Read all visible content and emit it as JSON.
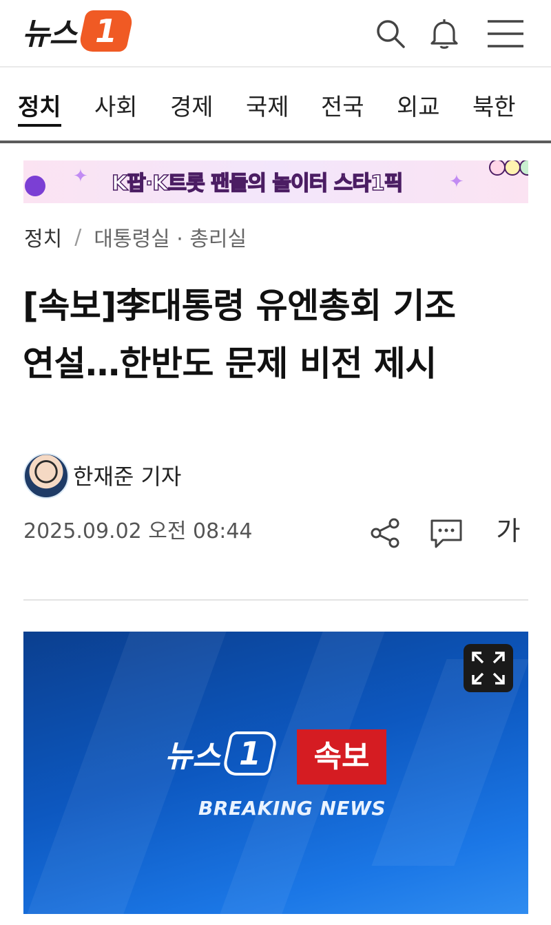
{
  "header": {
    "logo_text": "뉴스",
    "logo_mark": "1",
    "brand_color": "#f05a24",
    "icons": [
      "search-icon",
      "bell-icon",
      "menu-icon"
    ]
  },
  "nav": {
    "items": [
      {
        "label": "정치",
        "active": true
      },
      {
        "label": "사회",
        "active": false
      },
      {
        "label": "경제",
        "active": false
      },
      {
        "label": "국제",
        "active": false
      },
      {
        "label": "전국",
        "active": false
      },
      {
        "label": "외교",
        "active": false
      },
      {
        "label": "북한",
        "active": false
      }
    ]
  },
  "banner": {
    "text": "K팝·K트롯 팬들의 놀이터 스타1픽"
  },
  "breadcrumb": {
    "section": "정치",
    "separator": "/",
    "subsection": "대통령실 · 총리실"
  },
  "article": {
    "headline_line1": "[속보]李대통령 유엔총회 기조",
    "headline_line2": "연설…한반도 문제 비전 제시",
    "author": "한재준 기자",
    "date": "2025.09.02 오전 08:44",
    "font_size_label": "가"
  },
  "media": {
    "logo_text": "뉴스",
    "logo_mark": "1",
    "flash_label": "속보",
    "caption": "BREAKING NEWS",
    "flash_color": "#d51c22"
  }
}
